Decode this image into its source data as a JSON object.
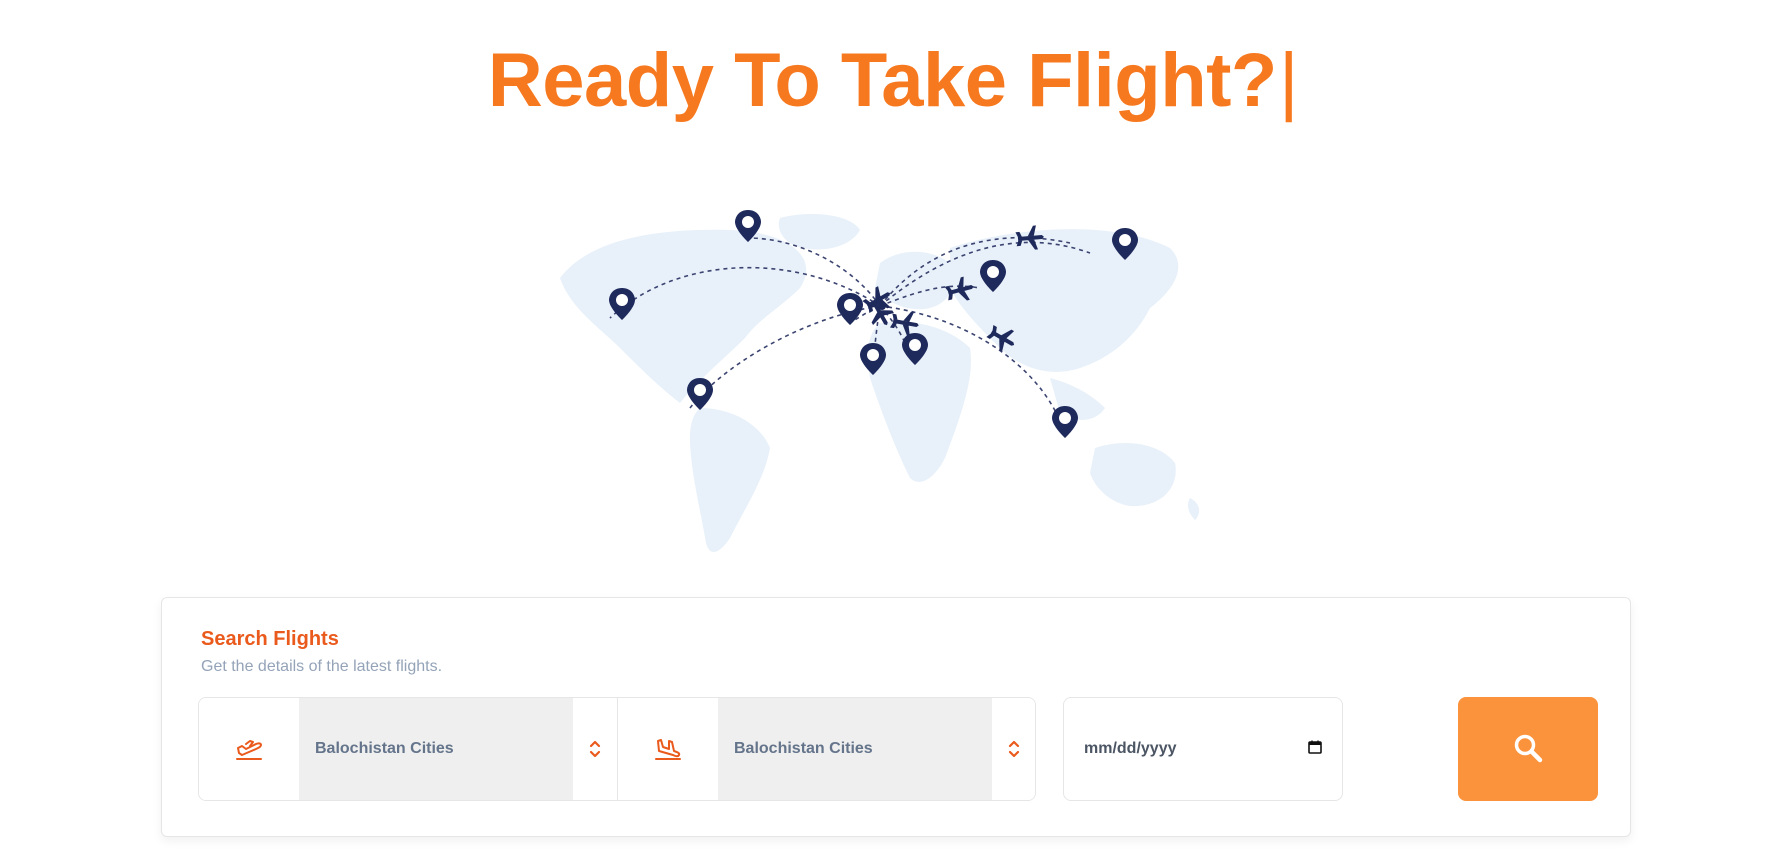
{
  "hero": {
    "title": "Ready To Take Flight?",
    "cursor": "|"
  },
  "map": {
    "land_color": "#e8f1fa",
    "pin_color": "#1f2a5c",
    "route_color": "#1f2a5c"
  },
  "search": {
    "title": "Search Flights",
    "subtitle": "Get the details of the latest flights.",
    "from": {
      "value": "Balochistan Cities",
      "icon": "plane-takeoff-icon"
    },
    "to": {
      "value": "Balochistan Cities",
      "icon": "plane-landing-icon"
    },
    "date": {
      "placeholder": "mm/dd/yyyy",
      "icon": "calendar-icon"
    },
    "button": {
      "icon": "search-icon"
    }
  },
  "colors": {
    "accent": "#f7791f",
    "accent_dark": "#ea5a1c",
    "button": "#fb923c",
    "muted": "#94a3b8"
  }
}
